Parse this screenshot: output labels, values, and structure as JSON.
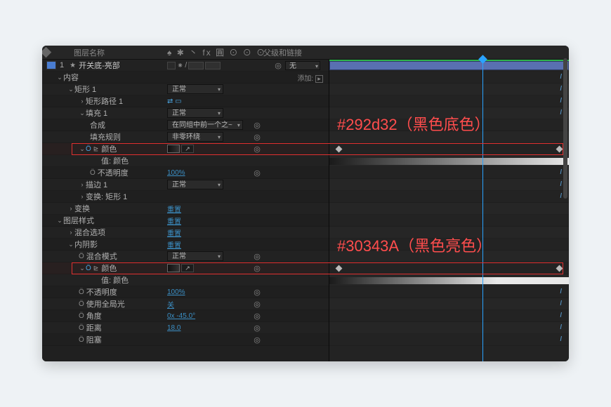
{
  "header": {
    "col_name": "图层名称",
    "col_switches": "♠ ✱ 丶 fx 圓 ⊙ ⊙ ⊙",
    "col_parent": "父级和链接"
  },
  "layer": {
    "number": "1",
    "name": "开关底-亮部",
    "parent": "无"
  },
  "rows": {
    "content": "内容",
    "add": "添加:",
    "rect1": "矩形 1",
    "rect_path": "矩形路径 1",
    "fill1": "填充 1",
    "composite": "合成",
    "fill_rule": "填充规则",
    "color": "颜色",
    "value_color": "值: 颜色",
    "opacity": "不透明度",
    "stroke1": "描边 1",
    "transform_rect": "变换: 矩形 1",
    "transform": "变换",
    "layer_styles": "图层样式",
    "blend_options": "混合选项",
    "inner_shadow": "内阴影",
    "blend_mode": "混合模式",
    "use_global": "使用全局光",
    "angle": "角度",
    "distance": "距离",
    "choke": "阻塞"
  },
  "values": {
    "normal": "正常",
    "composite_val": "在同组中前一个之~",
    "fill_rule_val": "非零环绕",
    "opacity": "100%",
    "reset": "重置",
    "off": "关",
    "angle": "0x -45.0°",
    "distance": "18.0",
    "opacity2": "100%"
  },
  "annotations": {
    "a1": "#292d32（黑色底色）",
    "a2": "#30343A（黑色亮色）"
  }
}
